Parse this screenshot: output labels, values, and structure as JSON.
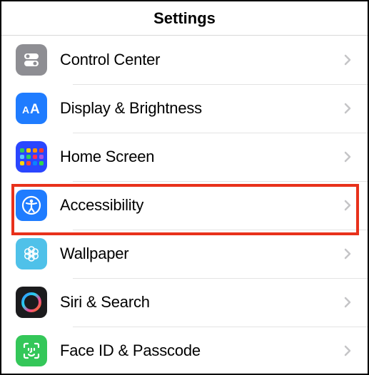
{
  "header": {
    "title": "Settings"
  },
  "rows": {
    "control_center": {
      "label": "Control Center"
    },
    "display_brightness": {
      "label": "Display & Brightness"
    },
    "home_screen": {
      "label": "Home Screen"
    },
    "accessibility": {
      "label": "Accessibility"
    },
    "wallpaper": {
      "label": "Wallpaper"
    },
    "siri_search": {
      "label": "Siri & Search"
    },
    "face_id_passcode": {
      "label": "Face ID & Passcode"
    }
  },
  "highlight": {
    "target": "accessibility",
    "color": "#e8311b"
  }
}
